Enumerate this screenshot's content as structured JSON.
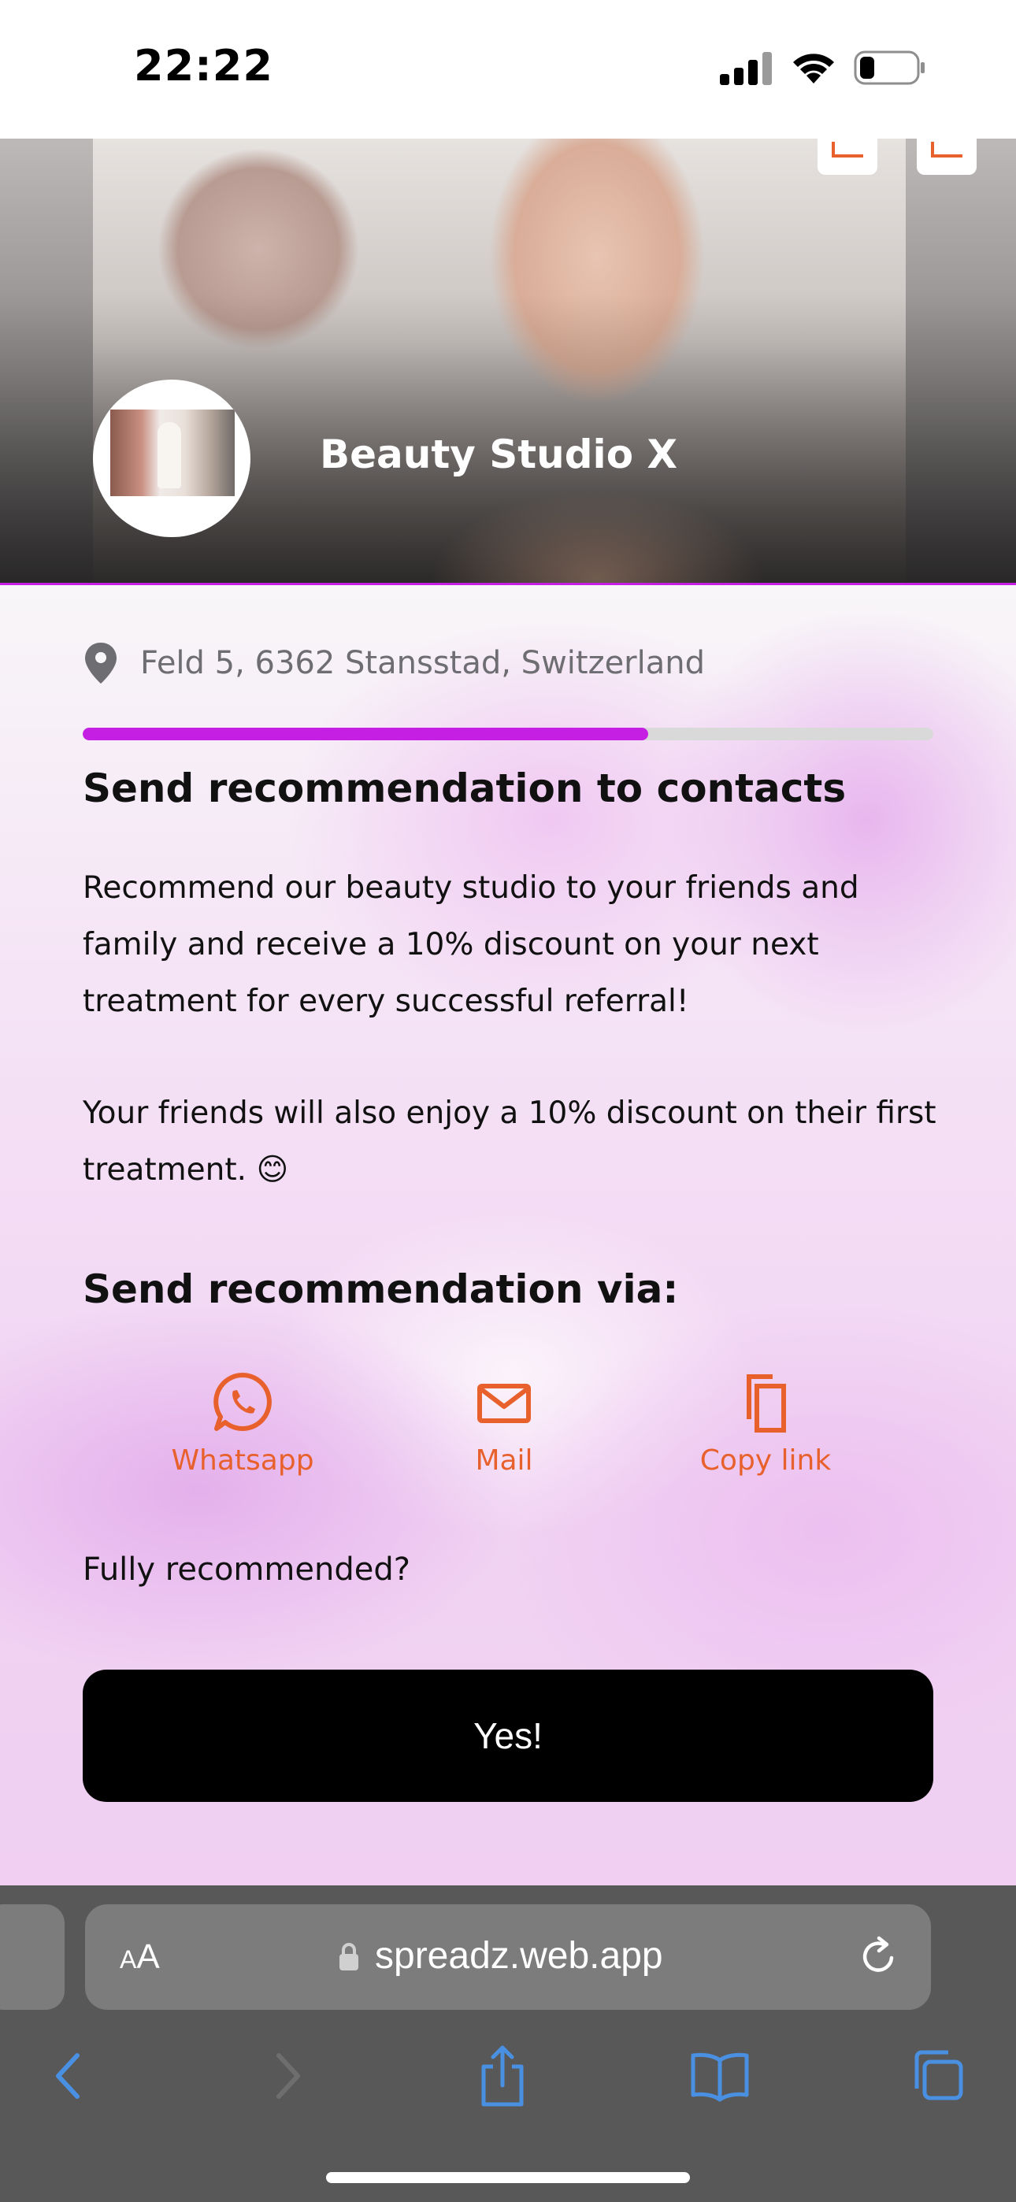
{
  "status_bar": {
    "time": "22:22"
  },
  "hero": {
    "studio_name": "Beauty Studio X"
  },
  "location": {
    "address": "Feld 5, 6362 Stansstad, Switzerland",
    "icon": "location-pin-icon"
  },
  "progress": {
    "percent": 66.5,
    "color": "#c51fe3"
  },
  "recommendation": {
    "title": "Send recommendation to contacts",
    "paragraph1": "Recommend our beauty studio to your friends and family and receive a 10% discount on your next treatment for every successful referral!",
    "paragraph2": "Your friends will also enjoy a 10% discount on their first treatment. 😊"
  },
  "share": {
    "title": "Send recommendation via:",
    "accent_color": "#e8602c",
    "options": [
      {
        "label": "Whatsapp",
        "icon": "whatsapp-icon"
      },
      {
        "label": "Mail",
        "icon": "mail-icon"
      },
      {
        "label": "Copy link",
        "icon": "copy-icon"
      }
    ]
  },
  "confirm": {
    "question": "Fully recommended?",
    "button_label": "Yes!"
  },
  "browser": {
    "text_size_label_small": "A",
    "text_size_label_big": "A",
    "url": "spreadz.web.app",
    "accent_color": "#4a90e2"
  }
}
